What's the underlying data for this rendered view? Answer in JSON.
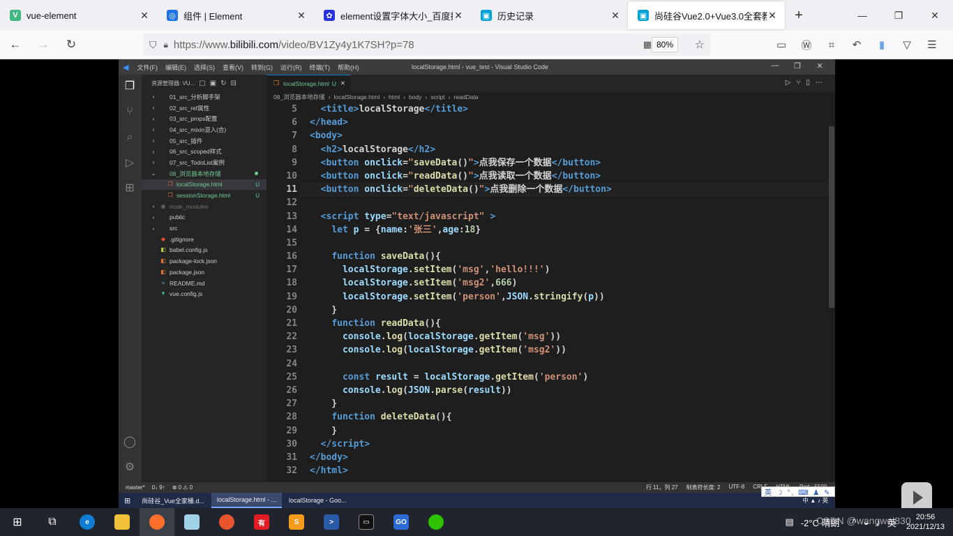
{
  "browser": {
    "tabs": [
      {
        "title": "vue-element",
        "color": "#41b883",
        "glyph": "V"
      },
      {
        "title": "组件 | Element",
        "color": "#1a73e8",
        "glyph": "◎"
      },
      {
        "title": "element设置字体大小_百度搜索",
        "color": "#2932e1",
        "glyph": "✿"
      },
      {
        "title": "历史记录",
        "color": "#00a1d6",
        "glyph": "▣"
      },
      {
        "title": "尚硅谷Vue2.0+Vue3.0全套教程",
        "color": "#00a1d6",
        "glyph": "▣"
      }
    ],
    "url_prefix": "https://www.",
    "url_domain": "bilibili.com",
    "url_path": "/video/BV1Zy4y1K7SH?p=78",
    "zoom": "80%"
  },
  "vscode": {
    "menu": [
      "文件(F)",
      "编辑(E)",
      "选择(S)",
      "查看(V)",
      "转到(G)",
      "运行(R)",
      "终端(T)",
      "帮助(H)"
    ],
    "window_title": "localStorage.html - vue_test - Visual Studio Code",
    "explorer_title": "资源管理器: VU...",
    "tree": [
      {
        "name": "01_src_分析脚手架",
        "type": "folder"
      },
      {
        "name": "02_src_ref属性",
        "type": "folder"
      },
      {
        "name": "03_src_props配置",
        "type": "folder"
      },
      {
        "name": "04_src_mixin混入(合)",
        "type": "folder"
      },
      {
        "name": "05_src_插件",
        "type": "folder"
      },
      {
        "name": "06_src_scoped样式",
        "type": "folder"
      },
      {
        "name": "07_src_TodoList案例",
        "type": "folder"
      },
      {
        "name": "08_浏览器本地存储",
        "type": "open"
      },
      {
        "name": "localStorage.html",
        "type": "html",
        "badge": "U",
        "sel": true
      },
      {
        "name": "sessionStorage.html",
        "type": "html",
        "badge": "U"
      },
      {
        "name": "node_modules",
        "type": "dim"
      },
      {
        "name": "public",
        "type": "folder"
      },
      {
        "name": "src",
        "type": "folder"
      },
      {
        "name": ".gitignore",
        "type": "git"
      },
      {
        "name": "babel.config.js",
        "type": "js"
      },
      {
        "name": "package-lock.json",
        "type": "json"
      },
      {
        "name": "package.json",
        "type": "json"
      },
      {
        "name": "README.md",
        "type": "md"
      },
      {
        "name": "vue.config.js",
        "type": "vue"
      }
    ],
    "editor_tab": "localStorage.html",
    "editor_tab_badge": "U",
    "breadcrumb": [
      "08_浏览器本地存储",
      "localStorage.html",
      "html",
      "body",
      "script",
      "readData"
    ],
    "line_numbers": [
      "5",
      "6",
      "7",
      "8",
      "9",
      "10",
      "11",
      "12",
      "13",
      "14",
      "15",
      "16",
      "17",
      "18",
      "19",
      "20",
      "21",
      "22",
      "23",
      "24",
      "25",
      "26",
      "27",
      "28",
      "29",
      "30",
      "31",
      "32"
    ],
    "status_left": [
      "master*",
      "0↓ 9↑",
      "⊗ 0 ⚠ 0"
    ],
    "status_right": [
      "行 11，列 27",
      "制表符长度: 2",
      "UTF-8",
      "CRLF",
      "HTML",
      "Port : 5500"
    ],
    "taskbar_items": [
      "尚硅谷_Vue全家桶.d...",
      "localStorage.html - ...",
      "localStorage - Goo..."
    ],
    "taskbar_right": "中 ▲ ♪ 英"
  },
  "ime": "英 ☽ °, ⌨ ♟ ✎",
  "tray": {
    "weather": "-2°C  晴朗",
    "time": "20:56",
    "date": "2021/12/13",
    "lang": "英"
  },
  "watermark": "CSDN @wangwei830"
}
